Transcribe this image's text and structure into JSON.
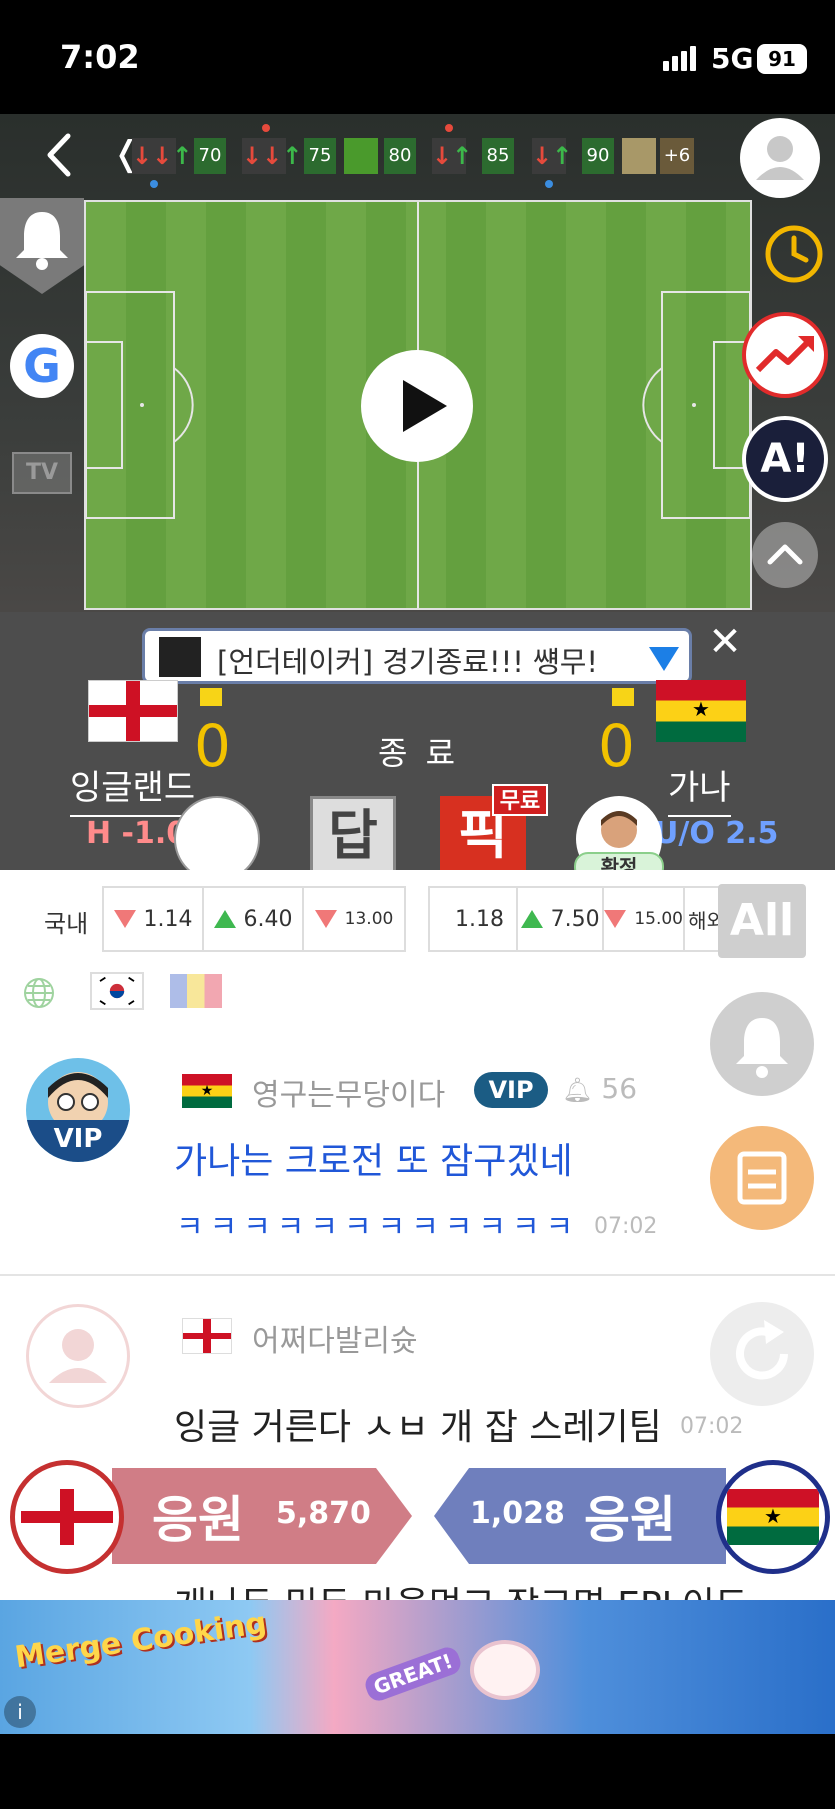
{
  "status_bar": {
    "time": "7:02",
    "network": "5G",
    "battery": "91"
  },
  "timeline": {
    "minutes": [
      "70",
      "75",
      "80",
      "85",
      "90"
    ],
    "more": "+6"
  },
  "side_buttons": {
    "tv": "TV",
    "google": "G",
    "ai": "A!"
  },
  "notice": {
    "text": "[언더테이커] 경기종료!!! 썡무!",
    "close": "✕"
  },
  "match": {
    "status": "종 료",
    "home": {
      "name": "잉글랜드",
      "score": "0",
      "line": "H -1.0"
    },
    "away": {
      "name": "가나",
      "score": "0",
      "line": "U/O 2.5"
    }
  },
  "actions": {
    "answer": "답",
    "pick": "픽",
    "free_badge": "무료",
    "confirm": "확정"
  },
  "odds": {
    "label": "국내",
    "group1": [
      "1.14",
      "6.40",
      "13.00"
    ],
    "group2": [
      "1.18",
      "7.50",
      "15.00",
      "해외"
    ],
    "all": "All"
  },
  "chat": [
    {
      "user": "영구는무당이다",
      "vip": "VIP",
      "avatar_tag": "VIP",
      "likes": "56",
      "message": "가나는 크로전 또 잠구겠네",
      "message2": "ㅋㅋㅋㅋㅋㅋㅋㅋㅋㅋㅋㅋ",
      "time": "07:02"
    },
    {
      "user": "어쩌다발리슛",
      "message": "잉글 거른다 ㅅㅂ 개 잡 스레기팀",
      "time": "07:02"
    }
  ],
  "partial_message": "개나두 믿두 마을먹고 잠그면 EPL이드",
  "support": {
    "home": {
      "label": "응원",
      "count": "5,870"
    },
    "away": {
      "label": "응원",
      "count": "1,028"
    }
  },
  "ad": {
    "title": "Merge Cooking",
    "badge": "GREAT!",
    "info": "i"
  },
  "colors": {
    "score": "#f2c200",
    "home_support": "#d07d86",
    "away_support": "#6f7fbd",
    "chat_highlight": "#2057d8"
  }
}
